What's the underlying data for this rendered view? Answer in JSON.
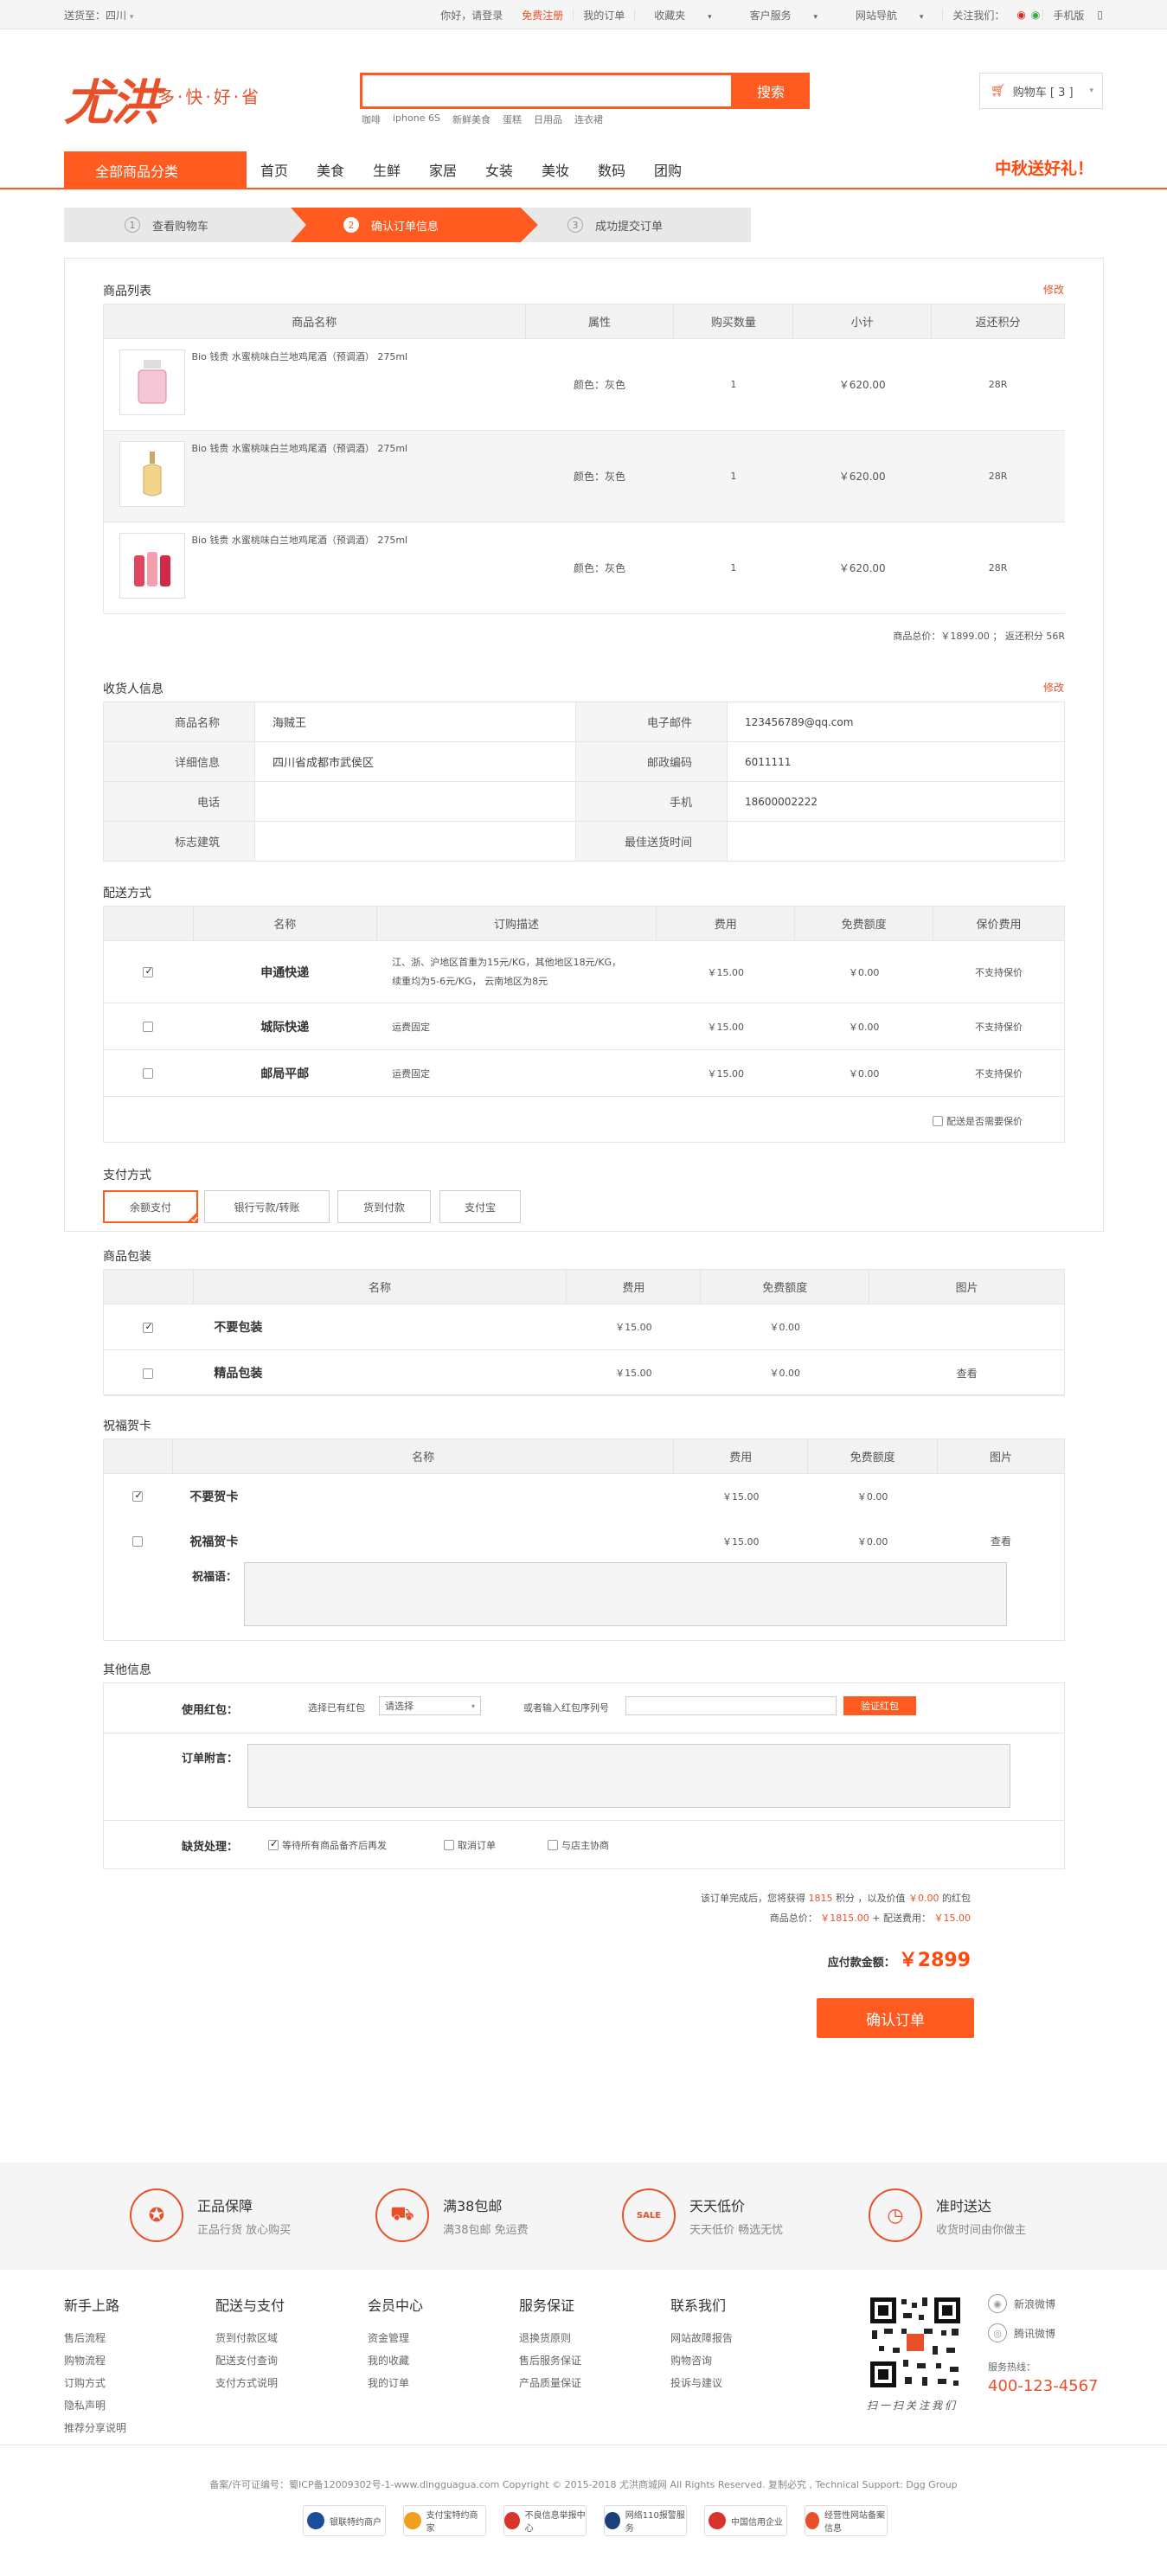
{
  "topbar": {
    "ship_to": "送货至：四川",
    "greeting": "你好，请登录",
    "register": "免费注册",
    "my_orders": "我的订单",
    "favorites": "收藏夹",
    "customer_service": "客户服务",
    "site_nav": "网站导航",
    "follow": "关注我们：",
    "mobile": "手机版"
  },
  "header": {
    "logo": "尤洪",
    "slogan": "多·快·好·省",
    "search_placeholder": "",
    "search_button": "搜索",
    "hot_words": [
      "咖啡",
      "iphone 6S",
      "新鲜美食",
      "蛋糕",
      "日用品",
      "连衣裙"
    ],
    "cart_label": "购物车 [ 3 ]"
  },
  "nav": {
    "all_categories": "全部商品分类",
    "items": [
      "首页",
      "美食",
      "生鲜",
      "家居",
      "女装",
      "美妆",
      "数码",
      "团购"
    ],
    "promo": "中秋送好礼！"
  },
  "steps": [
    {
      "num": "1",
      "label": "查看购物车"
    },
    {
      "num": "2",
      "label": "确认订单信息"
    },
    {
      "num": "3",
      "label": "成功提交订单"
    }
  ],
  "products": {
    "title": "商品列表",
    "edit": "修改",
    "headers": [
      "商品名称",
      "属性",
      "购买数量",
      "小计",
      "返还积分"
    ],
    "rows": [
      {
        "name": "Bio 钱贵 水蜜桃味白兰地鸡尾酒（预调酒） 275ml",
        "attr": "颜色：灰色",
        "qty": "1",
        "subtotal": "￥620.00",
        "points": "28R"
      },
      {
        "name": "Bio 钱贵 水蜜桃味白兰地鸡尾酒（预调酒） 275ml",
        "attr": "颜色：灰色",
        "qty": "1",
        "subtotal": "￥620.00",
        "points": "28R"
      },
      {
        "name": "Bio 钱贵 水蜜桃味白兰地鸡尾酒（预调酒） 275ml",
        "attr": "颜色：灰色",
        "qty": "1",
        "subtotal": "￥620.00",
        "points": "28R"
      }
    ],
    "total": "商品总价：￥1899.00 ； 返还积分 56R"
  },
  "receiver": {
    "title": "收货人信息",
    "edit": "修改",
    "rows": [
      {
        "l1": "商品名称",
        "v1": "海贼王",
        "l2": "电子邮件",
        "v2": "123456789@qq.com"
      },
      {
        "l1": "详细信息",
        "v1": "四川省成都市武侯区",
        "l2": "邮政编码",
        "v2": "6011111"
      },
      {
        "l1": "电话",
        "v1": "",
        "l2": "手机",
        "v2": "18600002222"
      },
      {
        "l1": "标志建筑",
        "v1": "",
        "l2": "最佳送货时间",
        "v2": ""
      }
    ]
  },
  "delivery": {
    "title": "配送方式",
    "headers": [
      "名称",
      "订购描述",
      "费用",
      "免费额度",
      "保价费用"
    ],
    "rows": [
      {
        "checked": true,
        "name": "申通快递",
        "desc1": "江、浙、沪地区首重为15元/KG，其他地区18元/KG，",
        "desc2": "续重均为5-6元/KG， 云南地区为8元",
        "fee": "￥15.00",
        "free": "￥0.00",
        "insure": "不支持保价"
      },
      {
        "checked": false,
        "name": "城际快递",
        "desc1": "运费固定",
        "desc2": "",
        "fee": "￥15.00",
        "free": "￥0.00",
        "insure": "不支持保价"
      },
      {
        "checked": false,
        "name": "邮局平邮",
        "desc1": "运费固定",
        "desc2": "",
        "fee": "￥15.00",
        "free": "￥0.00",
        "insure": "不支持保价"
      }
    ],
    "insure_option": "配送是否需要保价"
  },
  "payment": {
    "title": "支付方式",
    "options": [
      "余额支付",
      "银行亏款/转账",
      "货到付款",
      "支付宝"
    ]
  },
  "packaging": {
    "title": "商品包装",
    "headers": [
      "名称",
      "费用",
      "免费额度",
      "图片"
    ],
    "rows": [
      {
        "checked": true,
        "name": "不要包装",
        "fee": "￥15.00",
        "free": "￥0.00",
        "pic": ""
      },
      {
        "checked": false,
        "name": "精品包装",
        "fee": "￥15.00",
        "free": "￥0.00",
        "pic": "查看"
      }
    ]
  },
  "card": {
    "title": "祝福贺卡",
    "headers": [
      "名称",
      "费用",
      "免费额度",
      "图片"
    ],
    "rows": [
      {
        "checked": true,
        "name": "不要贺卡",
        "fee": "￥15.00",
        "free": "￥0.00",
        "pic": ""
      },
      {
        "checked": false,
        "name": "祝福贺卡",
        "fee": "￥15.00",
        "free": "￥0.00",
        "pic": "查看"
      }
    ],
    "message_label": "祝福语："
  },
  "other": {
    "title": "其他信息",
    "redpacket_label": "使用红包：",
    "select_redpacket": "选择已有红包",
    "select_value": "请选择",
    "input_serial": "或者输入红包序列号",
    "verify_button": "验证红包",
    "remark_label": "订单附言：",
    "stock_label": "缺货处理：",
    "stock_options": [
      {
        "checked": true,
        "label": "等待所有商品备齐后再发"
      },
      {
        "checked": false,
        "label": "取消订单"
      },
      {
        "checked": false,
        "label": "与店主协商"
      }
    ]
  },
  "summary": {
    "line1_a": "该订单完成后，您将获得",
    "line1_points": "1815",
    "line1_b": "积分 ，以及价值",
    "line1_value": "￥0.00",
    "line1_c": "的红包",
    "line2_a": "商品总价：",
    "line2_total": "￥1815.00",
    "line2_b": "+ 配送费用：",
    "line2_ship": "￥15.00",
    "payable_label": "应付款金额：",
    "payable": "￥2899",
    "confirm_button": "确认订单"
  },
  "services": [
    {
      "title": "正品保障",
      "desc": "正品行货 放心购买",
      "icon": "medal-icon"
    },
    {
      "title": "满38包邮",
      "desc": "满38包邮 免运费",
      "icon": "truck-icon"
    },
    {
      "title": "天天低价",
      "desc": "天天低价 畅选无忧",
      "icon": "sale-icon"
    },
    {
      "title": "准时送达",
      "desc": "收货时间由你做主",
      "icon": "clock-icon"
    }
  ],
  "footer_cols": [
    {
      "title": "新手上路",
      "items": [
        "售后流程",
        "购物流程",
        "订购方式",
        "隐私声明",
        "推荐分享说明"
      ]
    },
    {
      "title": "配送与支付",
      "items": [
        "货到付款区域",
        "配送支付查询",
        "支付方式说明"
      ]
    },
    {
      "title": "会员中心",
      "items": [
        "资金管理",
        "我的收藏",
        "我的订单"
      ]
    },
    {
      "title": "服务保证",
      "items": [
        "退换货原则",
        "售后服务保证",
        "产品质量保证"
      ]
    },
    {
      "title": "联系我们",
      "items": [
        "网站故障报告",
        "购物咨询",
        "投诉与建议"
      ]
    }
  ],
  "footer_right": {
    "weibo": "新浪微博",
    "tencent": "腾讯微博",
    "hotline_label": "服务热线：",
    "hotline": "400-123-4567",
    "qr_caption": "扫一扫关注我们"
  },
  "copyright": "备案/许可证编号：蜀ICP备12009302号-1-www.dingguagua.com Copyright © 2015-2018 尤洪商城网 All Rights Reserved. 复制必究 , Technical Support: Dgg Group",
  "badges": [
    "银联特约商户",
    "支付宝特约商家",
    "不良信息举报中心",
    "网络110报警服务",
    "中国信用企业",
    "经营性网站备案信息"
  ]
}
